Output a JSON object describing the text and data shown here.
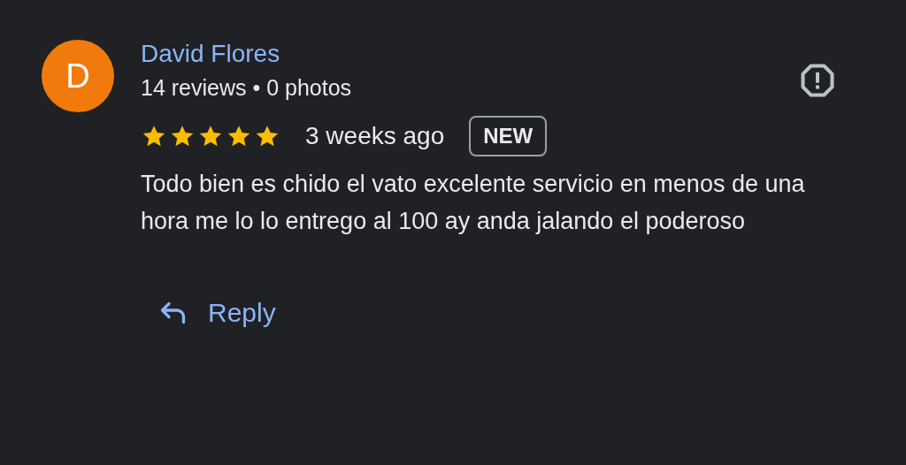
{
  "review": {
    "avatar": {
      "letter": "D",
      "color": "#f07b0c"
    },
    "author": "David Flores",
    "meta": "14 reviews • 0 photos",
    "stars": 5,
    "time": "3 weeks ago",
    "badge": "NEW",
    "text": "Todo bien es chido el vato excelente servicio en menos de una hora me lo lo entrego al 100 ay anda jalando el poderoso",
    "reply": "Reply"
  }
}
